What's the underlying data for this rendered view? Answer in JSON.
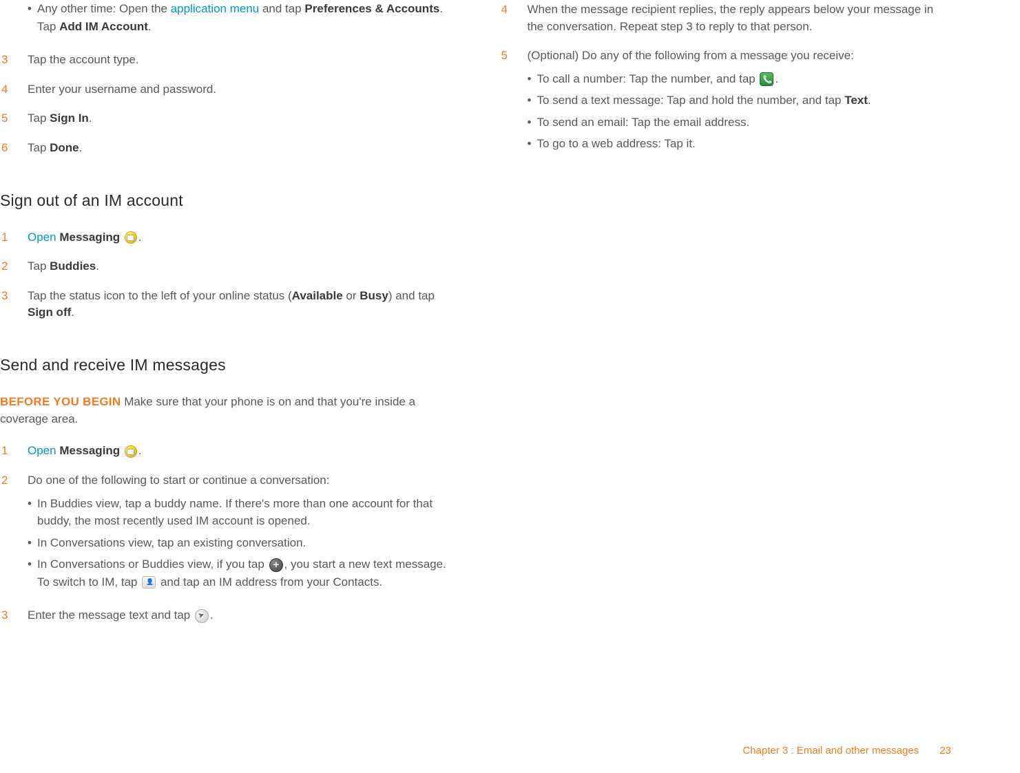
{
  "left": {
    "first_bullet": {
      "pre": "Any other time: Open the ",
      "link": "application menu",
      "mid": " and tap ",
      "b1": "Preferences & Accounts",
      "mid2": ". Tap ",
      "b2": "Add IM Account",
      "post": "."
    },
    "step3": "Tap the account type.",
    "step4": "Enter your username and password.",
    "step5_pre": "Tap ",
    "step5_b": "Sign In",
    "step5_post": ".",
    "step6_pre": "Tap ",
    "step6_b": "Done",
    "step6_post": ".",
    "section_signout": "Sign out of an IM account",
    "so_step1_open": "Open",
    "so_step1_b": "Messaging",
    "so_step1_post": ".",
    "so_step2_pre": "Tap ",
    "so_step2_b": "Buddies",
    "so_step2_post": ".",
    "so_step3_pre": "Tap the status icon to the left of your online status (",
    "so_step3_b1": "Available",
    "so_step3_mid": " or ",
    "so_step3_b2": "Busy",
    "so_step3_mid2": ") and tap ",
    "so_step3_b3": "Sign off",
    "so_step3_post": ".",
    "section_send": "Send and receive IM messages",
    "byb_label": "BEFORE YOU BEGIN",
    "byb_text": "  Make sure that your phone is on and that you're inside a coverage area.",
    "sr_step1_open": "Open",
    "sr_step1_b": "Messaging",
    "sr_step1_post": ".",
    "sr_step2": "Do one of the following to start or continue a conversation:",
    "sr_b1": "In Buddies view, tap a buddy name. If there's more than one account for that buddy, the most recently used IM account is opened.",
    "sr_b2": "In Conversations view, tap an existing conversation.",
    "sr_b3_pre": "In Conversations or Buddies view, if you tap ",
    "sr_b3_mid": ", you start a new text message. To switch to IM, tap ",
    "sr_b3_post": " and tap an IM address from your Contacts.",
    "sr_step3_pre": "Enter the message text and tap ",
    "sr_step3_post": "."
  },
  "right": {
    "step4": "When the message recipient replies, the reply appears below your message in the conversation. Repeat step 3 to reply to that person.",
    "step5": "(Optional) Do any of the following from a message you receive:",
    "r_b1_pre": "To call a number: Tap the number, and tap ",
    "r_b1_post": ".",
    "r_b2_pre": "To send a text message: Tap and hold the number, and tap ",
    "r_b2_b": "Text",
    "r_b2_post": ".",
    "r_b3": "To send an email: Tap the email address.",
    "r_b4": "To go to a web address: Tap it."
  },
  "footer": {
    "chapter": "Chapter 3  :  Email and other messages",
    "page": "23"
  }
}
